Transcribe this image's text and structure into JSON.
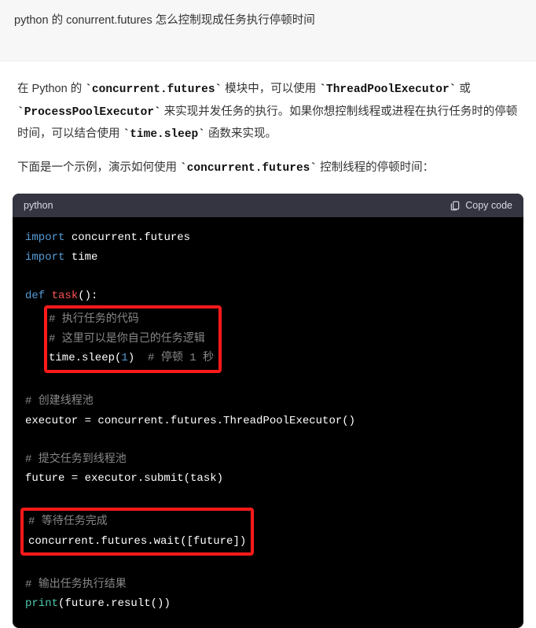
{
  "question": {
    "text": "python 的 conurrent.futures 怎么控制现成任务执行停顿时间"
  },
  "answer": {
    "p1_pre": "在 Python 的 ",
    "c1": "`concurrent.futures`",
    "p1_mid1": " 模块中，可以使用 ",
    "c2": "`ThreadPoolExecutor`",
    "p1_mid2": " 或 ",
    "c3": "`ProcessPoolExecutor`",
    "p1_mid3": " 来实现并发任务的执行。如果你想控制线程或进程在执行任务时的停顿时间，可以结合使用 ",
    "c4": "`time.sleep`",
    "p1_end": " 函数来实现。",
    "p2_pre": "下面是一个示例，演示如何使用 ",
    "c5": "`concurrent.futures`",
    "p2_end": " 控制线程的停顿时间："
  },
  "code": {
    "lang_label": "python",
    "copy_label": "Copy code",
    "kw_import": "import",
    "kw_def": "def",
    "mod_cf": "concurrent.futures",
    "mod_time": "time",
    "fn_task": "task",
    "cmt_task1": "# 执行任务的代码",
    "cmt_task2": "# 这里可以是你自己的任务逻辑",
    "sleep_call": "time.sleep(",
    "sleep_arg": "1",
    "sleep_close": ")  ",
    "sleep_cmt": "# 停顿 1 秒",
    "cmt_pool": "# 创建线程池",
    "exec_line": "executor = concurrent.futures.ThreadPoolExecutor()",
    "cmt_submit": "# 提交任务到线程池",
    "submit_line": "future = executor.submit(task)",
    "cmt_wait": "# 等待任务完成",
    "wait_line": "concurrent.futures.wait([future])",
    "cmt_print": "# 输出任务执行结果",
    "print_builtin": "print",
    "print_rest": "(future.result())"
  }
}
